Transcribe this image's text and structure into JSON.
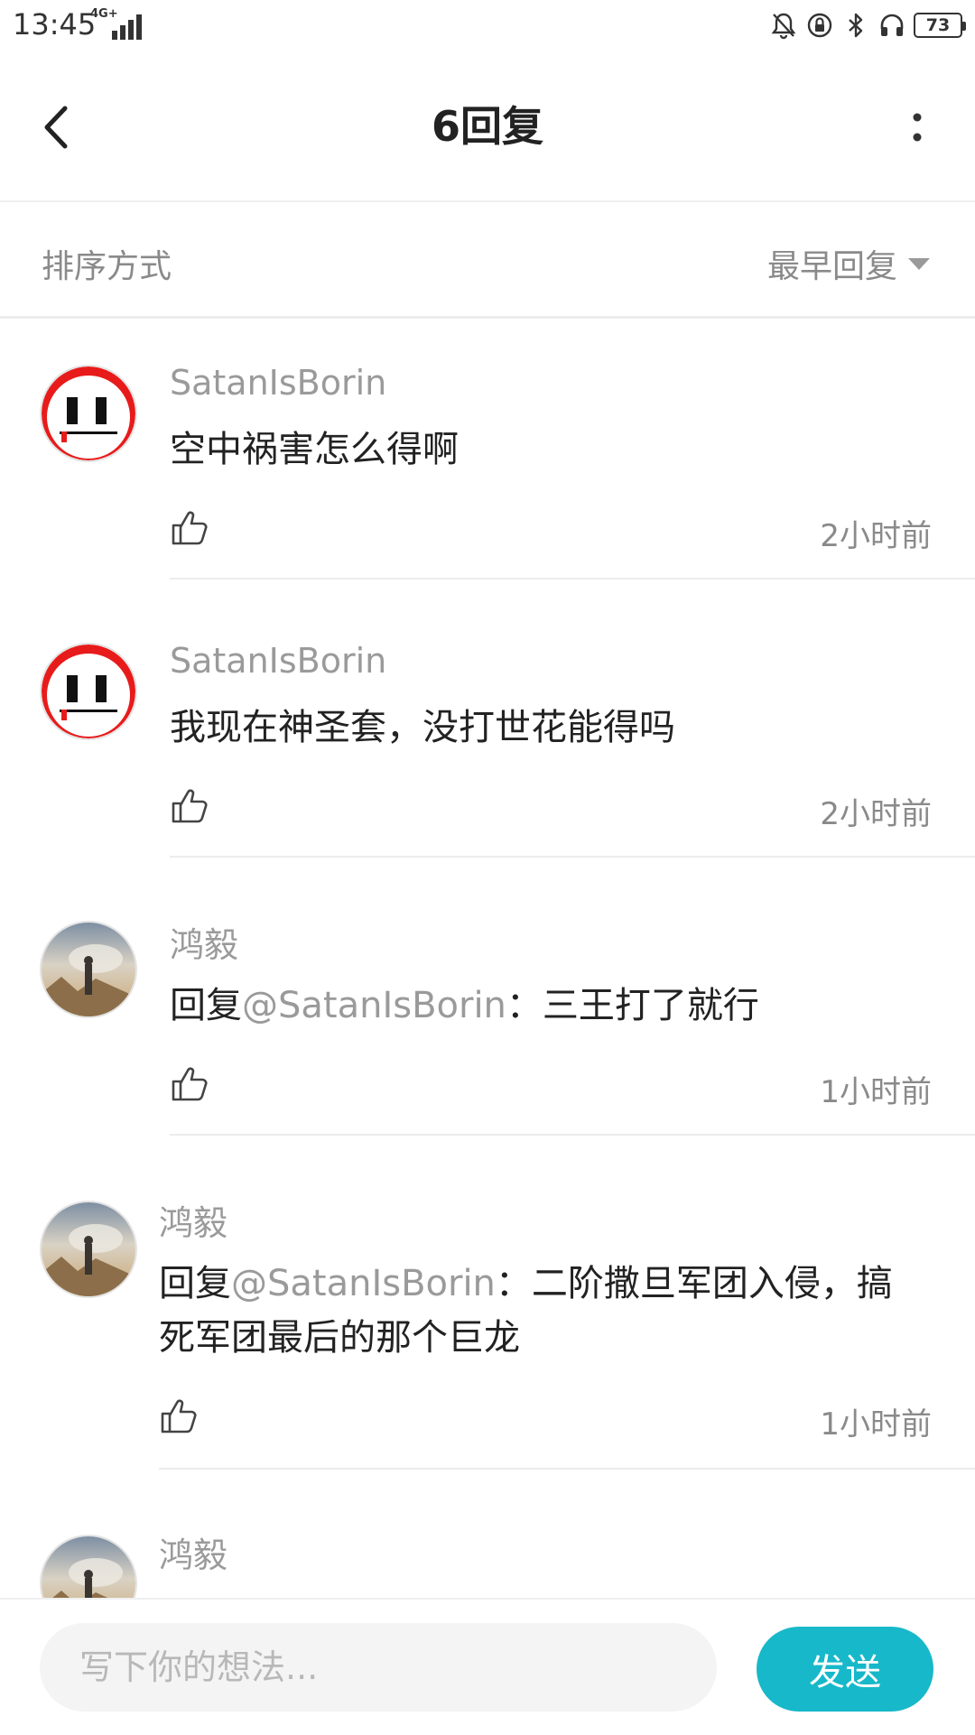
{
  "status_bar": {
    "time": "13:45",
    "network": "4G+",
    "battery": "73"
  },
  "header": {
    "title": "6回复",
    "back_icon": "chevron-left-icon",
    "more_icon": "more-vertical-icon"
  },
  "sort": {
    "label": "排序方式",
    "value": "最早回复"
  },
  "replies": [
    {
      "user": "SatanIsBorin",
      "prefix": "",
      "mention": "",
      "text": "空中祸害怎么得啊",
      "time": "2小时前",
      "avatar": "ghost-avatar"
    },
    {
      "user": "SatanIsBorin",
      "prefix": "",
      "mention": "",
      "text": "我现在神圣套，没打世花能得吗",
      "time": "2小时前",
      "avatar": "ghost-avatar"
    },
    {
      "user": "鸿毅",
      "prefix": "回复",
      "mention": "@SatanIsBorin",
      "text": "：三王打了就行",
      "time": "1小时前",
      "avatar": "landscape-avatar"
    },
    {
      "user": "鸿毅",
      "prefix": "回复",
      "mention": "@SatanIsBorin",
      "text": "：二阶撒旦军团入侵，搞死军团最后的那个巨龙",
      "time": "1小时前",
      "avatar": "landscape-avatar"
    },
    {
      "user": "鸿毅",
      "prefix": "",
      "mention": "",
      "text": "",
      "time": "",
      "avatar": "landscape-avatar"
    }
  ],
  "composer": {
    "placeholder": "写下你的想法...",
    "send_label": "发送"
  },
  "colors": {
    "accent": "#17b8c9",
    "muted_text": "#8a8a8a"
  }
}
